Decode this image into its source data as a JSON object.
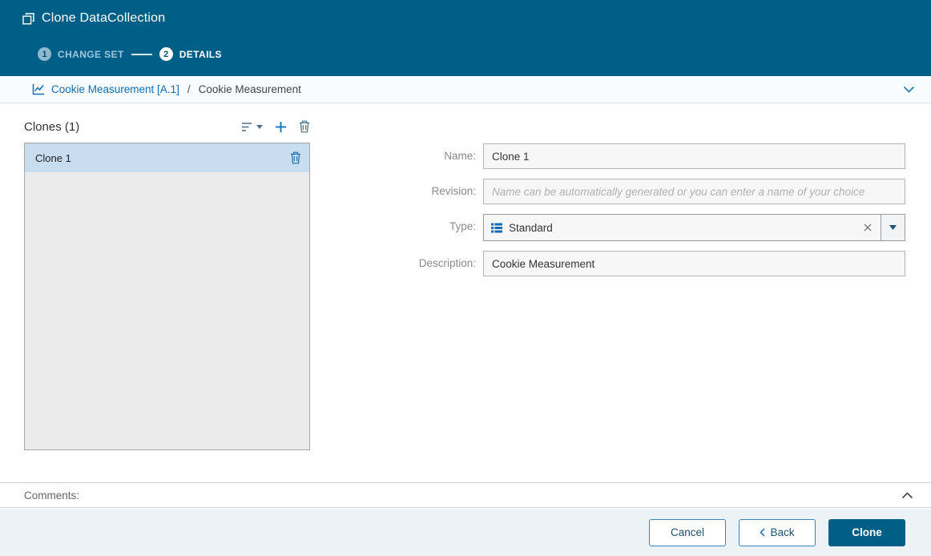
{
  "header": {
    "title": "Clone DataCollection",
    "steps": [
      {
        "number": "1",
        "label": "CHANGE SET",
        "active": false
      },
      {
        "number": "2",
        "label": "DETAILS",
        "active": true
      }
    ]
  },
  "breadcrumb": {
    "link": "Cookie Measurement [A.1]",
    "separator": "/",
    "current": "Cookie Measurement"
  },
  "clones": {
    "title": "Clones (1)",
    "items": [
      {
        "label": "Clone 1",
        "selected": true
      }
    ]
  },
  "form": {
    "name": {
      "label": "Name:",
      "value": "Clone 1"
    },
    "revision": {
      "label": "Revision:",
      "placeholder": "Name can be automatically generated or you can enter a name of your choice"
    },
    "type": {
      "label": "Type:",
      "value": "Standard"
    },
    "description": {
      "label": "Description:",
      "value": "Cookie Measurement"
    }
  },
  "comments": {
    "label": "Comments:"
  },
  "footer": {
    "cancel_label": "Cancel",
    "back_label": "Back",
    "clone_label": "Clone"
  },
  "icons": [
    "clone-icon",
    "chart-icon",
    "filter-icon",
    "chevron-down-icon",
    "plus-icon",
    "trash-icon",
    "table-type-icon",
    "clear-x-icon",
    "dropdown-caret-icon",
    "chevron-up-icon",
    "chevron-left-icon"
  ],
  "colors": {
    "header_blue": "#005f87",
    "link_blue": "#0f6db5",
    "selected_row": "#c8def0",
    "primary_button": "#005f87",
    "footer_background": "#edf2f6"
  }
}
